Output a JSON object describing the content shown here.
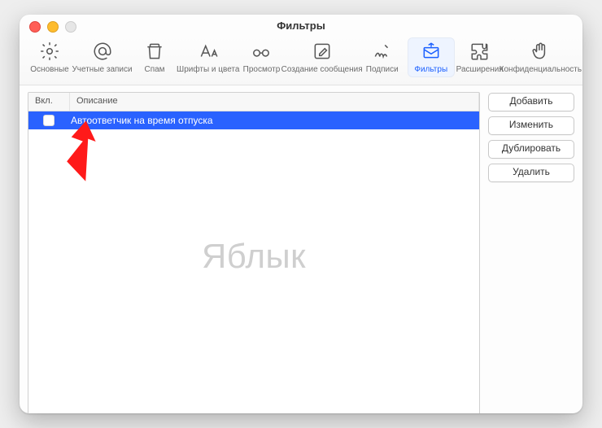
{
  "window": {
    "title": "Фильтры"
  },
  "toolbar": {
    "items": [
      {
        "label": "Основные"
      },
      {
        "label": "Учетные записи"
      },
      {
        "label": "Спам"
      },
      {
        "label": "Шрифты и цвета"
      },
      {
        "label": "Просмотр"
      },
      {
        "label": "Создание сообщения"
      },
      {
        "label": "Подписи"
      },
      {
        "label": "Фильтры"
      },
      {
        "label": "Расширения"
      },
      {
        "label": "Конфиденциальность"
      }
    ]
  },
  "list": {
    "columns": {
      "enabled": "Вкл.",
      "description": "Описание"
    },
    "rows": [
      {
        "enabled": false,
        "description": "Автоответчик на время отпуска"
      }
    ]
  },
  "buttons": {
    "add": "Добавить",
    "edit": "Изменить",
    "duplicate": "Дублировать",
    "delete": "Удалить"
  },
  "watermark": "Яблык"
}
